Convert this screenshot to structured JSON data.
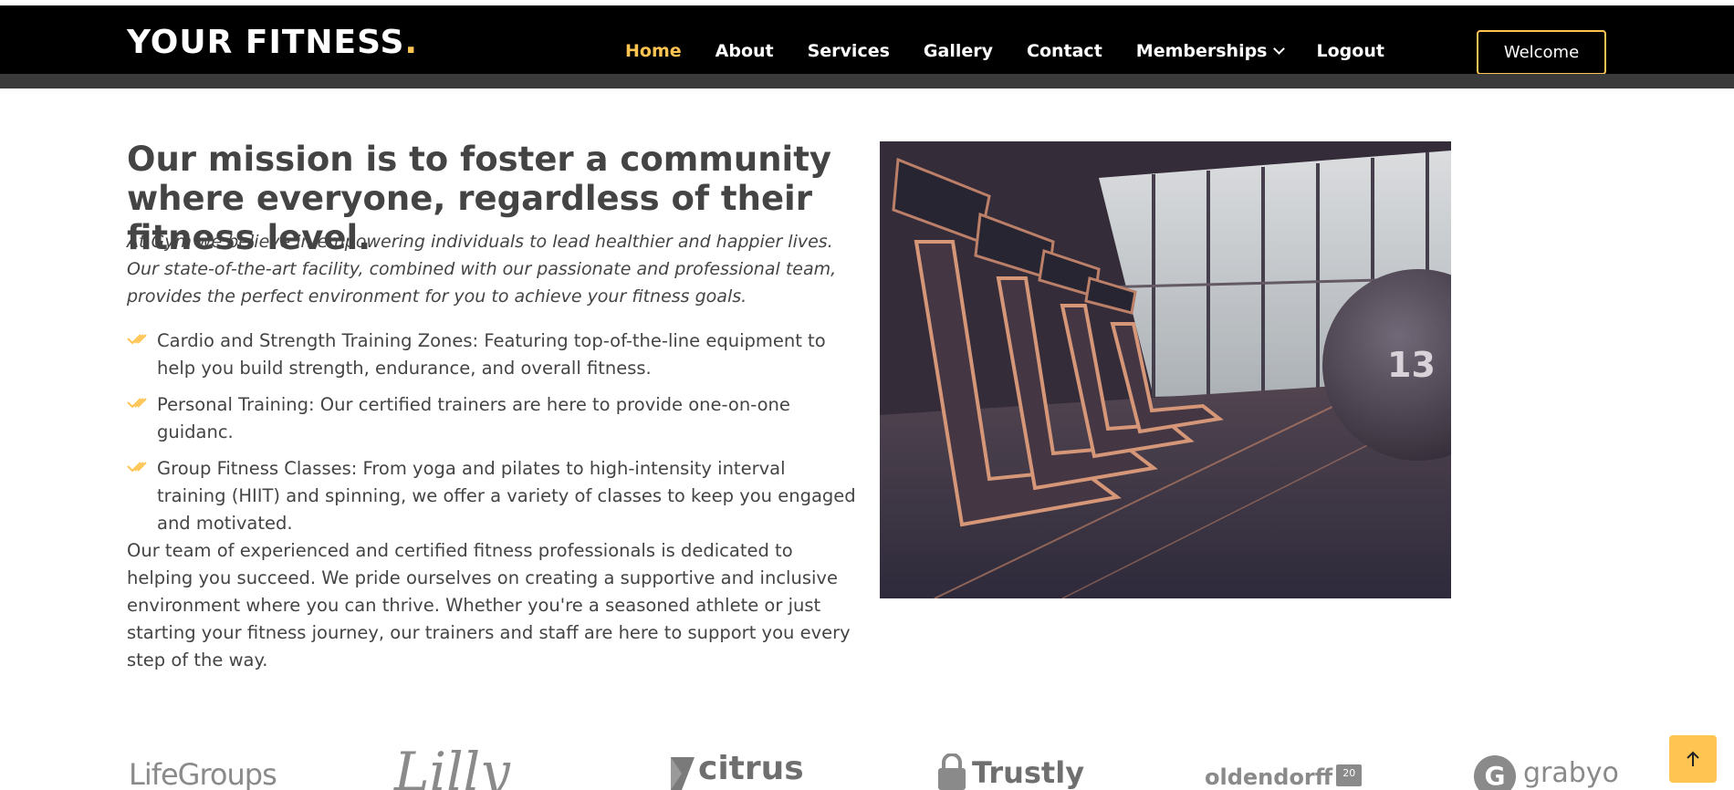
{
  "header": {
    "logo_text": "YOUR FITNESS",
    "logo_dot": ".",
    "nav": [
      {
        "label": "Home",
        "active": true
      },
      {
        "label": "About"
      },
      {
        "label": "Services"
      },
      {
        "label": "Gallery"
      },
      {
        "label": "Contact"
      },
      {
        "label": "Memberships",
        "has_dropdown": true
      },
      {
        "label": "Logout"
      }
    ],
    "welcome_label": "Welcome",
    "accent_color": "#ffc451"
  },
  "about": {
    "heading": "Our mission is to foster a community where everyone, regardless of their fitness level.",
    "lead": "At Gym we believe in empowering individuals to lead healthier and happier lives. Our state-of-the-art facility, combined with our passionate and professional team, provides the perfect environment for you to achieve your fitness goals.",
    "features": [
      "Cardio and Strength Training Zones: Featuring top-of-the-line equipment to help you build strength, endurance, and overall fitness.",
      "Personal Training: Our certified trainers are here to provide one-on-one guidanc.",
      "Group Fitness Classes: From yoga and pilates to high-intensity interval training (HIIT) and spinning, we offer a variety of classes to keep you engaged and motivated."
    ],
    "body": "Our team of experienced and certified fitness professionals is dedicated to helping you succeed. We pride ourselves on creating a supportive and inclusive environment where you can thrive. Whether you're a seasoned athlete or just starting your fitness journey, our trainers and staff are here to support you every step of the way.",
    "image_icon": "gym-treadmills-image",
    "image_number": "13"
  },
  "clients": {
    "logos": [
      "LifeGroups",
      "Lilly",
      "citrus",
      "Trustly",
      "oldendorff",
      "grabyo"
    ],
    "oldendorff_badge": "20"
  },
  "back_to_top": {
    "icon": "arrow-up-icon"
  }
}
